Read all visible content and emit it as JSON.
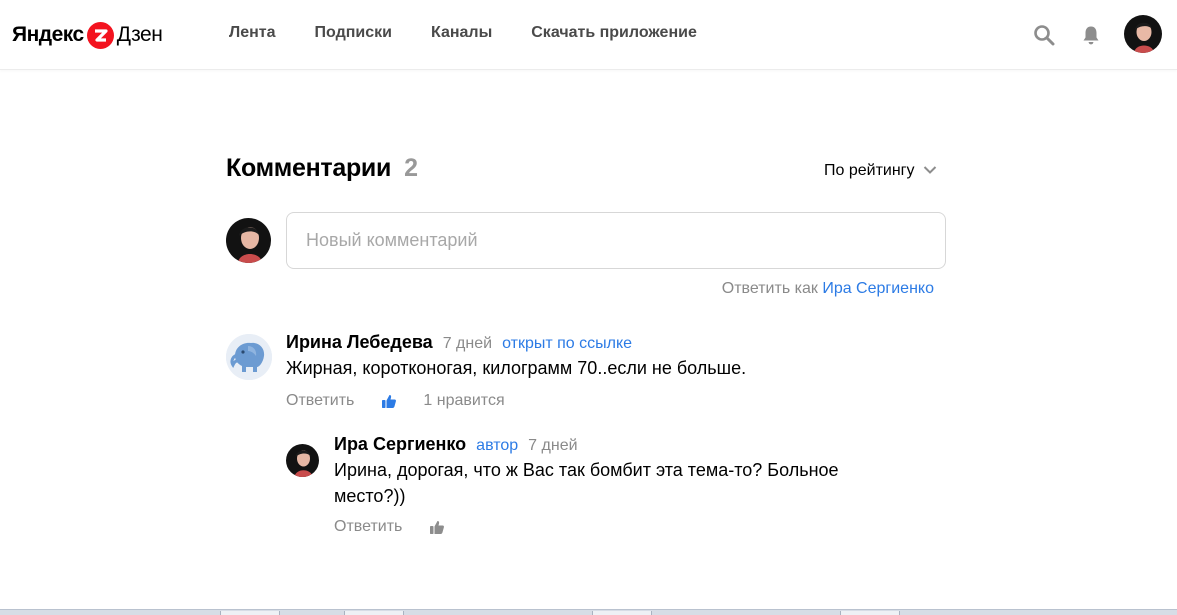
{
  "header": {
    "logo_brand": "Яндекс",
    "logo_product": "Дзен",
    "nav": [
      "Лента",
      "Подписки",
      "Каналы",
      "Скачать приложение"
    ],
    "icons": {
      "search": "search-icon",
      "notifications": "bell-icon",
      "avatar": "user-avatar"
    }
  },
  "comments": {
    "title": "Комментарии",
    "count": "2",
    "sort_label": "По рейтингу",
    "input_placeholder": "Новый комментарий",
    "reply_as_prefix": "Ответить как",
    "reply_as_name": "Ира Сергиенко",
    "items": [
      {
        "author": "Ирина Лебедева",
        "age": "7 дней",
        "tag": "открыт по ссылке",
        "text": "Жирная, коротконогая, килограмм 70..если не больше.",
        "reply_label": "Ответить",
        "likes": "1 нравится"
      },
      {
        "author": "Ира Сергиенко",
        "tag": "автор",
        "age": "7 дней",
        "text": "Ирина, дорогая, что ж Вас так бомбит эта тема-то? Больное место?))",
        "reply_label": "Ответить"
      }
    ]
  },
  "colors": {
    "brand_red": "#f3131f",
    "link_blue": "#2c7be5",
    "muted": "#8a8a8a"
  }
}
